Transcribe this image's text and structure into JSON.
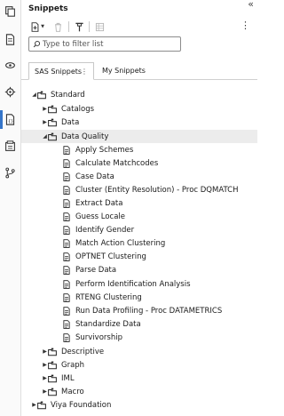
{
  "panel": {
    "title": "Snippets",
    "collapse_icon": "«",
    "kebab_icon": "⋮"
  },
  "activity_bar": {
    "icons": [
      "copy-icon",
      "document-icon",
      "library-icon",
      "settings-gear-icon",
      "snippets-icon",
      "tasks-icon",
      "git-branch-icon"
    ],
    "active": "snippets-icon",
    "accent_color": "#3575c9"
  },
  "toolbar": {
    "new_icon": "new-snippet-icon",
    "delete_icon": "trash-icon",
    "filter_icon": "filter-icon",
    "table_icon": "table-icon"
  },
  "filter": {
    "placeholder": "Type to filter list",
    "value": ""
  },
  "tabs": [
    {
      "label": "SAS Snippets",
      "selected": true,
      "menu_icon": "⋮"
    },
    {
      "label": "My Snippets",
      "selected": false
    }
  ],
  "tree": {
    "root": {
      "label": "Standard",
      "expanded": true
    },
    "standard_children": [
      {
        "label": "Catalogs",
        "expanded": false
      },
      {
        "label": "Data",
        "expanded": false
      },
      {
        "label": "Data Quality",
        "expanded": true,
        "selected": true
      }
    ],
    "data_quality_items": [
      "Apply Schemes",
      "Calculate Matchcodes",
      "Case Data",
      "Cluster (Entity Resolution) - Proc DQMATCH",
      "Extract Data",
      "Guess Locale",
      "Identify Gender",
      "Match Action Clustering",
      "OPTNET Clustering",
      "Parse Data",
      "Perform Identification Analysis",
      "RTENG Clustering",
      "Run Data Profiling - Proc DATAMETRICS",
      "Standardize Data",
      "Survivorship"
    ],
    "more_folders": [
      {
        "label": "Descriptive",
        "expanded": false
      },
      {
        "label": "Graph",
        "expanded": false
      },
      {
        "label": "IML",
        "expanded": false
      },
      {
        "label": "Macro",
        "expanded": false
      }
    ],
    "second_root": {
      "label": "Viya Foundation",
      "expanded": false
    },
    "caret_expanded": "◢",
    "caret_collapsed": "▶"
  }
}
